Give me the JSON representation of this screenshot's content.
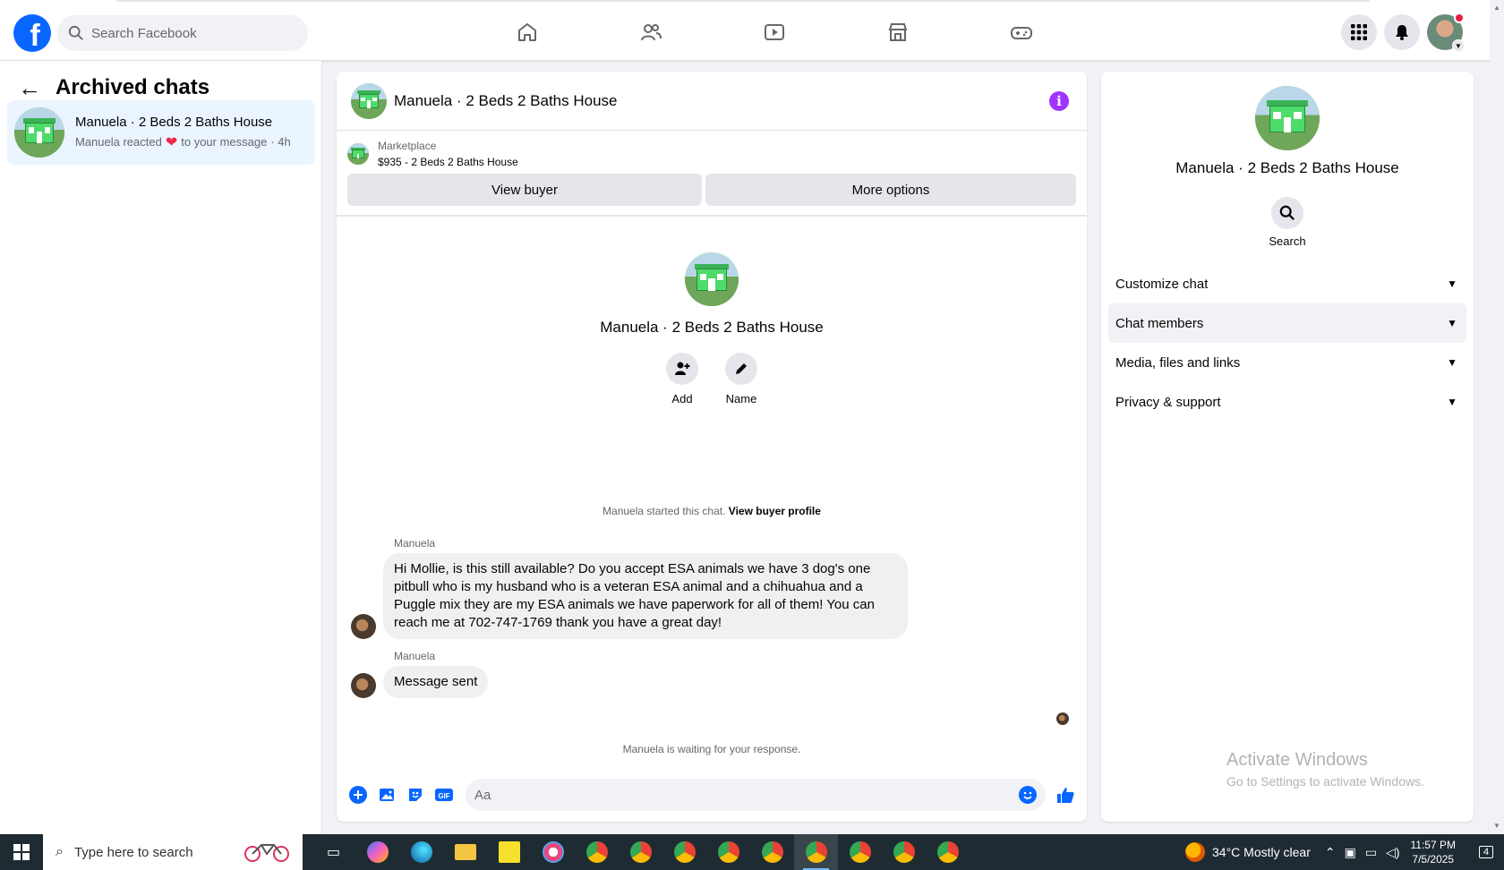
{
  "topbar": {
    "logo": "f",
    "search_placeholder": "Search Facebook",
    "nav_icons": [
      "home-icon",
      "friends-icon",
      "video-icon",
      "marketplace-icon",
      "gaming-icon"
    ],
    "right_icons": [
      "menu-grid-icon",
      "notifications-icon",
      "profile-avatar"
    ]
  },
  "left": {
    "title": "Archived chats",
    "chat": {
      "name": "Manuela · 2 Beds 2 Baths House",
      "preview_before": "Manuela reacted",
      "preview_after": "to your message",
      "time": "· 4h"
    }
  },
  "conversation": {
    "header_name": "Manuela · 2 Beds 2 Baths House",
    "marketplace_label": "Marketplace",
    "marketplace_item": "$935 - 2 Beds 2 Baths House",
    "view_buyer": "View buyer",
    "more_options": "More options",
    "profile_name": "Manuela · 2 Beds 2 Baths House",
    "add_label": "Add",
    "name_label": "Name",
    "started_text": "Manuela started this chat.",
    "view_buyer_profile": "View buyer profile",
    "messages": [
      {
        "sender": "Manuela",
        "text": "Hi Mollie, is this still available? Do you accept ESA animals we have 3 dog's one pitbull who is my husband who is a veteran ESA animal and a chihuahua and a Puggle mix they are my ESA animals we have paperwork for all of them! You can reach me at 702-747-1769 thank you have a great day!"
      },
      {
        "sender": "Manuela",
        "text": "Message sent"
      }
    ],
    "waiting_text": "Manuela is waiting for your response.",
    "composer_placeholder": "Aa"
  },
  "details": {
    "name": "Manuela · 2 Beds 2 Baths House",
    "search_label": "Search",
    "sections": [
      "Customize chat",
      "Chat members",
      "Media, files and links",
      "Privacy & support"
    ]
  },
  "watermark": {
    "title": "Activate Windows",
    "subtitle": "Go to Settings to activate Windows."
  },
  "taskbar": {
    "search_text": "Type here to search",
    "weather": "34°C  Mostly clear",
    "time": "11:57 PM",
    "date": "7/5/2025",
    "notification_count": "4"
  },
  "colors": {
    "facebook_blue": "#0866ff",
    "info_purple": "#a033ff",
    "selected_chat_bg": "#ebf5ff",
    "taskbar_bg": "#1f2b33"
  }
}
